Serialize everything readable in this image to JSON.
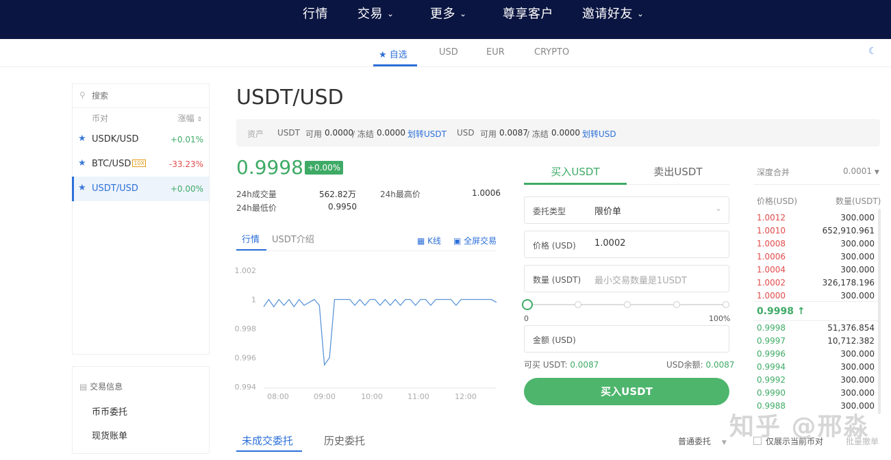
{
  "top_nav": [
    {
      "label": "行情",
      "dropdown": false
    },
    {
      "label": "交易",
      "dropdown": true
    },
    {
      "label": "更多",
      "dropdown": true
    },
    {
      "label": "尊享客户",
      "dropdown": false
    },
    {
      "label": "邀请好友",
      "dropdown": true
    }
  ],
  "sub_tabs": [
    {
      "label": "自选",
      "active": true
    },
    {
      "label": "USD"
    },
    {
      "label": "EUR"
    },
    {
      "label": "CRYPTO"
    }
  ],
  "sidebar": {
    "search_placeholder": "搜索",
    "col_pair": "币对",
    "col_change": "涨幅",
    "pairs": [
      {
        "name": "USDK/USD",
        "change": "+0.01%",
        "dir": "up"
      },
      {
        "name": "BTC/USD",
        "leverage": "10X",
        "change": "-33.23%",
        "dir": "down"
      },
      {
        "name": "USDT/USD",
        "change": "+0.00%",
        "dir": "up",
        "active": true
      }
    ],
    "info_title": "交易信息",
    "links": [
      "币币委托",
      "现货账单"
    ]
  },
  "pair_title": "USDT/USD",
  "assets": {
    "label": "资产",
    "usdt_prefix": "USDT",
    "usdt_avail_label": "可用",
    "usdt_avail": "0.0000",
    "usdt_frozen_label": "/ 冻结",
    "usdt_frozen": "0.0000",
    "usdt_transfer": "划转USDT",
    "usd_prefix": "USD",
    "usd_avail_label": "可用",
    "usd_avail": "0.0087",
    "usd_frozen_label": "/ 冻结",
    "usd_frozen": "0.0000",
    "usd_transfer": "划转USD"
  },
  "ticker": {
    "price": "0.9998",
    "change": "+0.00%",
    "vol_label": "24h成交量",
    "vol": "562.82万",
    "high_label": "24h最高价",
    "high": "1.0006",
    "low_label": "24h最低价",
    "low": "0.9950"
  },
  "chart_tabs": {
    "market": "行情",
    "intro": "USDT介绍",
    "kline": "K线",
    "fullscreen": "全屏交易"
  },
  "chart_data": {
    "type": "line",
    "x_ticks": [
      "08:00",
      "09:00",
      "10:00",
      "11:00",
      "12:00"
    ],
    "y_ticks": [
      "1.002",
      "1",
      "0.998",
      "0.996",
      "0.994"
    ],
    "ylim": [
      0.994,
      1.002
    ],
    "series": [
      {
        "values": [
          0.9995,
          1.0,
          0.9995,
          1.0,
          0.9996,
          1.0,
          0.9995,
          1.0,
          0.9996,
          0.9998,
          1.0,
          0.9996,
          0.9955,
          0.996,
          1.0,
          1.0,
          1.0,
          1.0,
          0.9996,
          1.0,
          0.9996,
          1.0,
          1.0,
          0.9996,
          1.0,
          0.9996,
          1.0,
          0.9996,
          1.0,
          1.0,
          0.9996,
          1.0,
          1.0,
          0.9996,
          1.0,
          1.0,
          1.0,
          1.0,
          0.9996,
          1.0,
          1.0,
          1.0,
          1.0,
          1.0,
          1.0,
          1.0,
          0.9998
        ]
      }
    ]
  },
  "order_form": {
    "buy_tab": "买入USDT",
    "sell_tab": "卖出USDT",
    "type_label": "委托类型",
    "type_value": "限价单",
    "price_label": "价格 (USD)",
    "price_value": "1.0002",
    "qty_label": "数量 (USDT)",
    "qty_placeholder": "最小交易数量是1USDT",
    "slider_min": "0",
    "slider_max": "100%",
    "slider_value": 0,
    "amount_label": "金额 (USD)",
    "avail_buy_label": "可买 USDT:",
    "avail_buy": "0.0087",
    "usd_balance_label": "USD余额:",
    "usd_balance": "0.0087",
    "submit": "买入USDT"
  },
  "orderbook": {
    "depth_label": "深度合并",
    "depth_value": "0.0001",
    "col_price": "价格(USD)",
    "col_qty": "数量(USDT)",
    "asks": [
      {
        "p": "1.0012",
        "q": "300.000"
      },
      {
        "p": "1.0010",
        "q": "652,910.961"
      },
      {
        "p": "1.0008",
        "q": "300.000"
      },
      {
        "p": "1.0006",
        "q": "300.000"
      },
      {
        "p": "1.0004",
        "q": "300.000"
      },
      {
        "p": "1.0002",
        "q": "326,178.196"
      },
      {
        "p": "1.0000",
        "q": "300.000"
      }
    ],
    "last": "0.9998",
    "bids": [
      {
        "p": "0.9998",
        "q": "51,376.854"
      },
      {
        "p": "0.9997",
        "q": "10,712.382"
      },
      {
        "p": "0.9996",
        "q": "300.000"
      },
      {
        "p": "0.9994",
        "q": "300.000"
      },
      {
        "p": "0.9992",
        "q": "300.000"
      },
      {
        "p": "0.9990",
        "q": "300.000"
      },
      {
        "p": "0.9988",
        "q": "300.000"
      }
    ]
  },
  "bottom": {
    "open_orders": "未成交委托",
    "history": "历史委托",
    "order_type": "普通委托",
    "only_current": "仅展示当前币对",
    "batch_cancel": "批量撤单"
  },
  "watermark": "知乎 @邢淼",
  "colors": {
    "nav_bg": "#0b1541",
    "accent": "#2c6fd8",
    "up": "#3eaa66",
    "down": "#e24a4a",
    "line": "#5b96d8"
  }
}
